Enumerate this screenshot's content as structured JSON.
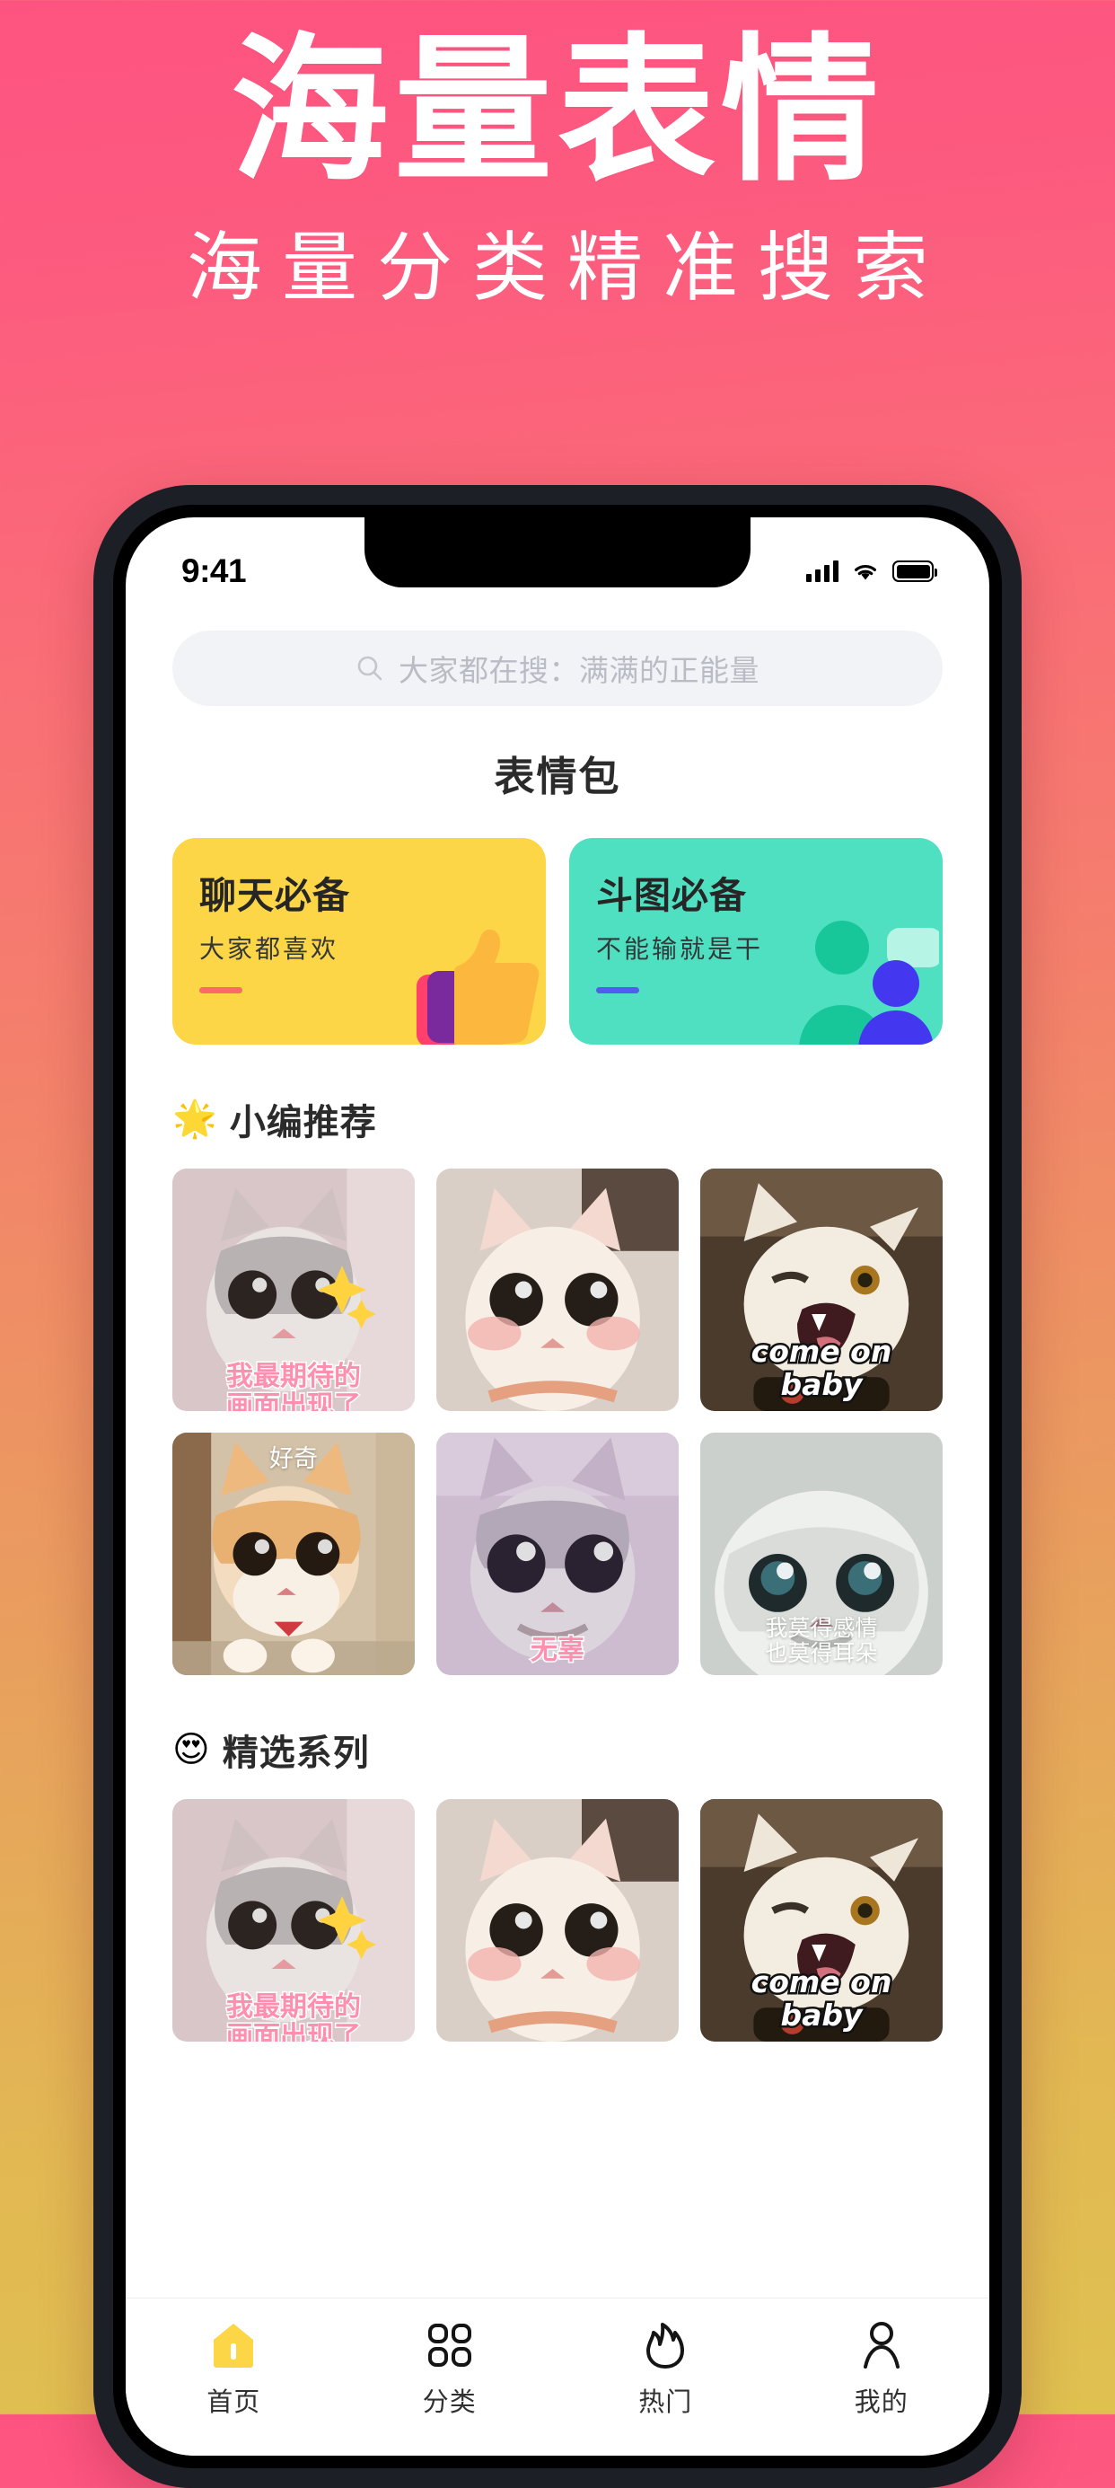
{
  "promo": {
    "title": "海量表情",
    "subtitle": "海量分类精准搜索",
    "bg_top_color": "#FD5380",
    "bg_bottom_color": "#DFC150"
  },
  "statusbar": {
    "time": "9:41",
    "signal_icon": "cellular-signal-icon",
    "wifi_icon": "wifi-icon",
    "battery_icon": "battery-icon"
  },
  "search": {
    "icon": "search-icon",
    "placeholder": "大家都在搜：满满的正能量"
  },
  "page_title": "表情包",
  "cards": [
    {
      "title": "聊天必备",
      "subtitle": "大家都喜欢",
      "bg_color": "#FCD646",
      "rule_color": "#FA6A67",
      "art_icon": "thumbs-up-icon"
    },
    {
      "title": "斗图必备",
      "subtitle": "不能输就是干",
      "bg_color": "#4FE0C2",
      "rule_color": "#4F5EF0",
      "art_icon": "two-people-icon"
    }
  ],
  "sections": [
    {
      "emoji": "🌟",
      "emoji_name": "glowing-star-emoji",
      "title": "小编推荐",
      "tiles": [
        {
          "caption": "我最期待的\n画面出现了",
          "caption_style": "pink",
          "caption_pos": "overflow",
          "alt": "惊讶的星星眼猫咪表情包"
        },
        {
          "caption": "",
          "caption_style": "",
          "caption_pos": "",
          "alt": "粉脸大眼白猫表情包"
        },
        {
          "caption": "come on baby",
          "caption_style": "black",
          "caption_pos": "bottom",
          "alt": "张嘴吼叫的白猫表情包"
        },
        {
          "caption": "好奇",
          "caption_style": "white",
          "caption_pos": "top",
          "alt": "趴在玻璃上的橘白猫表情包"
        },
        {
          "caption": "无辜",
          "caption_style": "pink",
          "caption_pos": "bottom",
          "alt": "无辜大眼银渐层猫表情包"
        },
        {
          "caption": "我莫得感情\n也莫得耳朵",
          "caption_style": "whitesm",
          "caption_pos": "bottom",
          "alt": "仰头大眼白猫表情包"
        }
      ]
    },
    {
      "emoji": "😍",
      "emoji_name": "heart-eyes-emoji",
      "title": "精选系列",
      "tiles": [
        {
          "caption": "我最期待的\n画面出现了",
          "caption_style": "pink",
          "caption_pos": "overflow",
          "alt": "惊讶的星星眼猫咪表情包"
        },
        {
          "caption": "",
          "caption_style": "",
          "caption_pos": "",
          "alt": "粉脸大眼白猫表情包"
        },
        {
          "caption": "come on baby",
          "caption_style": "black",
          "caption_pos": "bottom",
          "alt": "张嘴吼叫的白猫表情包"
        }
      ]
    }
  ],
  "tabbar": {
    "items": [
      {
        "label": "首页",
        "icon": "home-icon",
        "active": true
      },
      {
        "label": "分类",
        "icon": "grid-icon",
        "active": false
      },
      {
        "label": "热门",
        "icon": "flame-icon",
        "active": false
      },
      {
        "label": "我的",
        "icon": "person-icon",
        "active": false
      }
    ],
    "active_color": "#FCD646",
    "inactive_color": "#1A1A1A"
  }
}
